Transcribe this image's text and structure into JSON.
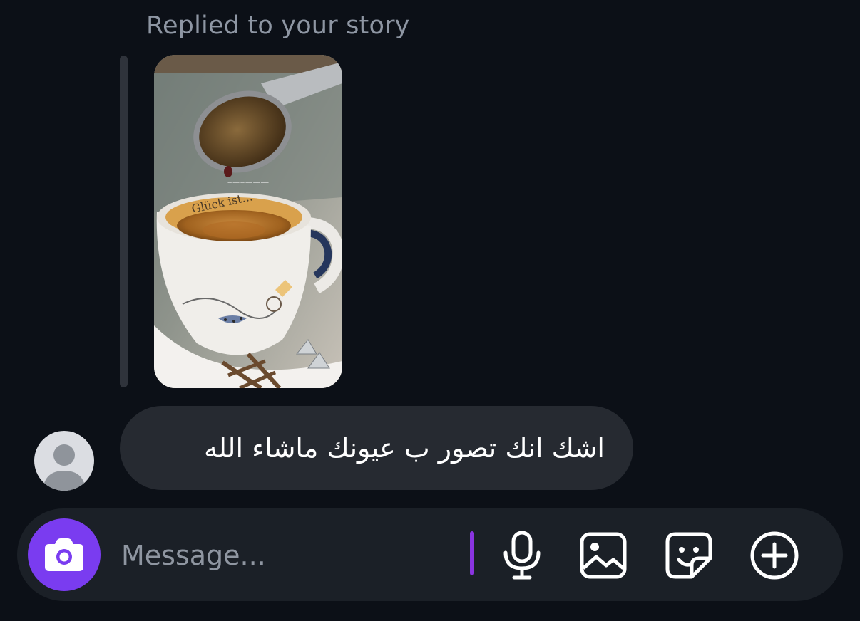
{
  "story_reply": {
    "header": "Replied to your story"
  },
  "message": {
    "text": "اشك انك تصور ب عيونك ماشاء الله"
  },
  "composer": {
    "placeholder": "Message..."
  },
  "icons": {
    "camera": "camera-icon",
    "microphone": "microphone-icon",
    "gallery": "gallery-icon",
    "sticker": "sticker-icon",
    "add": "plus-circle-icon",
    "avatar": "default-avatar-icon"
  },
  "colors": {
    "background": "#0c1017",
    "bubble": "#262a31",
    "composer": "#1b2027",
    "accent": "#7a3cf0"
  }
}
